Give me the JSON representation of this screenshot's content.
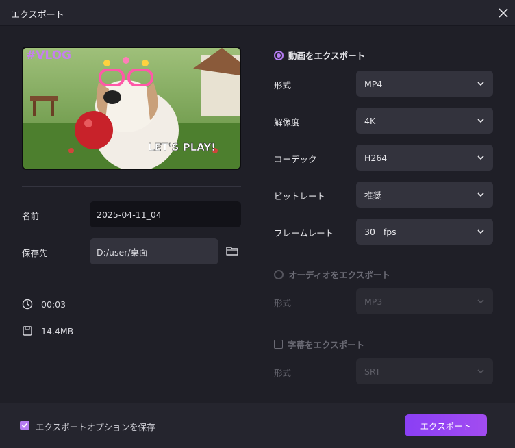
{
  "window": {
    "title": "エクスポート"
  },
  "preview": {
    "overlay_tl": "#VLOG",
    "overlay_br": "LET'S PLAY!"
  },
  "left": {
    "name_label": "名前",
    "name_value": "2025-04-11_04",
    "path_label": "保存先",
    "path_value": "D:/user/桌面",
    "duration": "00:03",
    "size": "14.4MB"
  },
  "video": {
    "section_label": "動画をエクスポート",
    "format_label": "形式",
    "format_value": "MP4",
    "resolution_label": "解像度",
    "resolution_value": "4K",
    "codec_label": "コーデック",
    "codec_value": "H264",
    "bitrate_label": "ビットレート",
    "bitrate_value": "推奨",
    "framerate_label": "フレームレート",
    "framerate_value": "30   fps"
  },
  "audio": {
    "section_label": "オーディオをエクスポート",
    "format_label": "形式",
    "format_value": "MP3"
  },
  "subtitle": {
    "section_label": "字幕をエクスポート",
    "format_label": "形式",
    "format_value": "SRT"
  },
  "footer": {
    "save_label": "エクスポートオプションを保存",
    "export_label": "エクスポート"
  },
  "colors": {
    "accent": "#b57cf2",
    "button": "#9a46f2",
    "background": "#1f1f27"
  }
}
